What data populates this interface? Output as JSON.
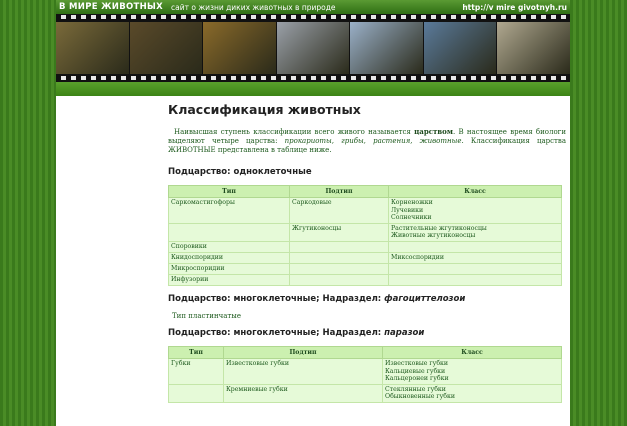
{
  "header": {
    "site_name": "В МИРЕ ЖИВОТНЫХ",
    "tagline": "сайт о жизни диких животных в природе",
    "url": "http://v mire givotnyh.ru"
  },
  "filmstrip_colors": [
    "#7a6a3a",
    "#5a4a2a",
    "#8a6a2a",
    "#9aa0a8",
    "#9ab0c8",
    "#5a7a9a",
    "#b0a890"
  ],
  "page": {
    "title": "Классификация животных",
    "intro": {
      "part1": "Наивысшая ступень классификации всего живого называется ",
      "bold1": "царством",
      "part2": ". В настоящее время биологи выделяют четыре царства: ",
      "italic1": "прокариоты, грибы, растения, животные",
      "part3": ". Классификация царства ЖИВОТНЫЕ представлена в таблице ниже."
    }
  },
  "section1": {
    "heading": "Подцарство: одноклеточные",
    "headers": [
      "Тип",
      "Подтип",
      "Класс"
    ],
    "rows": [
      {
        "type": "Саркомастигофоры",
        "subtype": "Саркодовые",
        "classes": [
          "Корненожки",
          "Лучевики",
          "Солнечники"
        ]
      },
      {
        "type": "",
        "subtype": "Жгутиконосцы",
        "classes": [
          "Растительные жгутиконосцы",
          "Животные жгутиконосцы"
        ]
      },
      {
        "type": "Споровики",
        "subtype": "",
        "classes": []
      },
      {
        "type": "Книдоспоридии",
        "subtype": "",
        "classes": [
          "Миксоспоридии"
        ]
      },
      {
        "type": "Микроспоридии",
        "subtype": "",
        "classes": []
      },
      {
        "type": "Инфузории",
        "subtype": "",
        "classes": []
      }
    ]
  },
  "section2": {
    "heading_prefix": "Подцарство: многоклеточные; Надраздел: ",
    "heading_italic": "фагоциттелозои",
    "note": "Тип пластинчатые"
  },
  "section3": {
    "heading_prefix": "Подцарство: многоклеточные; Надраздел: ",
    "heading_italic": "паразои",
    "headers": [
      "Тип",
      "Подтип",
      "Класс"
    ],
    "rows": [
      {
        "type": "Губки",
        "subtype": "Известковые губки",
        "classes": [
          "Известковые губки",
          "Кальциевые губки",
          "Кальцеронеи губки"
        ]
      },
      {
        "type": "",
        "subtype": "Кремниевые губки",
        "classes": [
          "Стеклянные губки",
          "Обыкновенные губки"
        ]
      }
    ]
  }
}
